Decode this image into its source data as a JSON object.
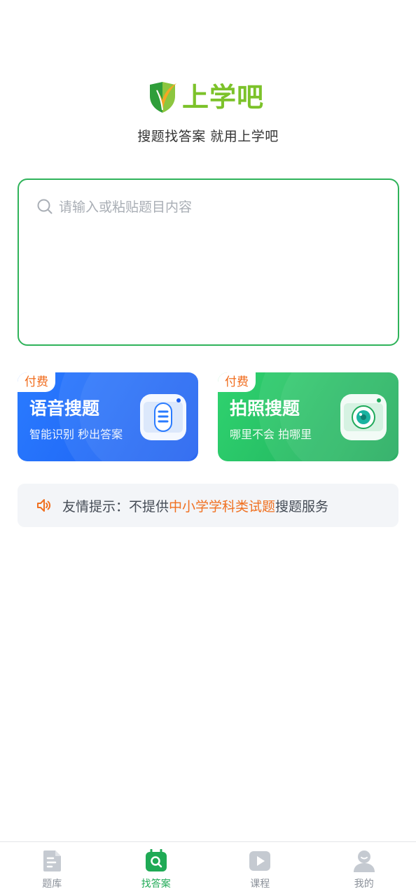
{
  "brand": {
    "logo_text": "上学吧",
    "slogan": "搜题找答案 就用上学吧"
  },
  "search": {
    "placeholder": "请输入或粘贴题目内容",
    "value": ""
  },
  "cards": [
    {
      "badge": "付费",
      "title": "语音搜题",
      "subtitle": "智能识别 秒出答案",
      "icon": "microphone-icon"
    },
    {
      "badge": "付费",
      "title": "拍照搜题",
      "subtitle": "哪里不会 拍哪里",
      "icon": "camera-icon"
    }
  ],
  "tip": {
    "prefix": "友情提示：不提供",
    "highlight": "中小学学科类试题",
    "suffix": "搜题服务",
    "icon": "speaker-icon"
  },
  "tabbar": {
    "items": [
      {
        "label": "题库",
        "icon": "document-icon",
        "active": false
      },
      {
        "label": "找答案",
        "icon": "search-answer-icon",
        "active": true
      },
      {
        "label": "课程",
        "icon": "play-icon",
        "active": false
      },
      {
        "label": "我的",
        "icon": "user-icon",
        "active": false
      }
    ]
  },
  "colors": {
    "accent_green": "#2fb35a",
    "voice_card_blue": "#1a5cf0",
    "photo_card_green": "#1ea95a",
    "highlight_orange": "#f07020"
  }
}
